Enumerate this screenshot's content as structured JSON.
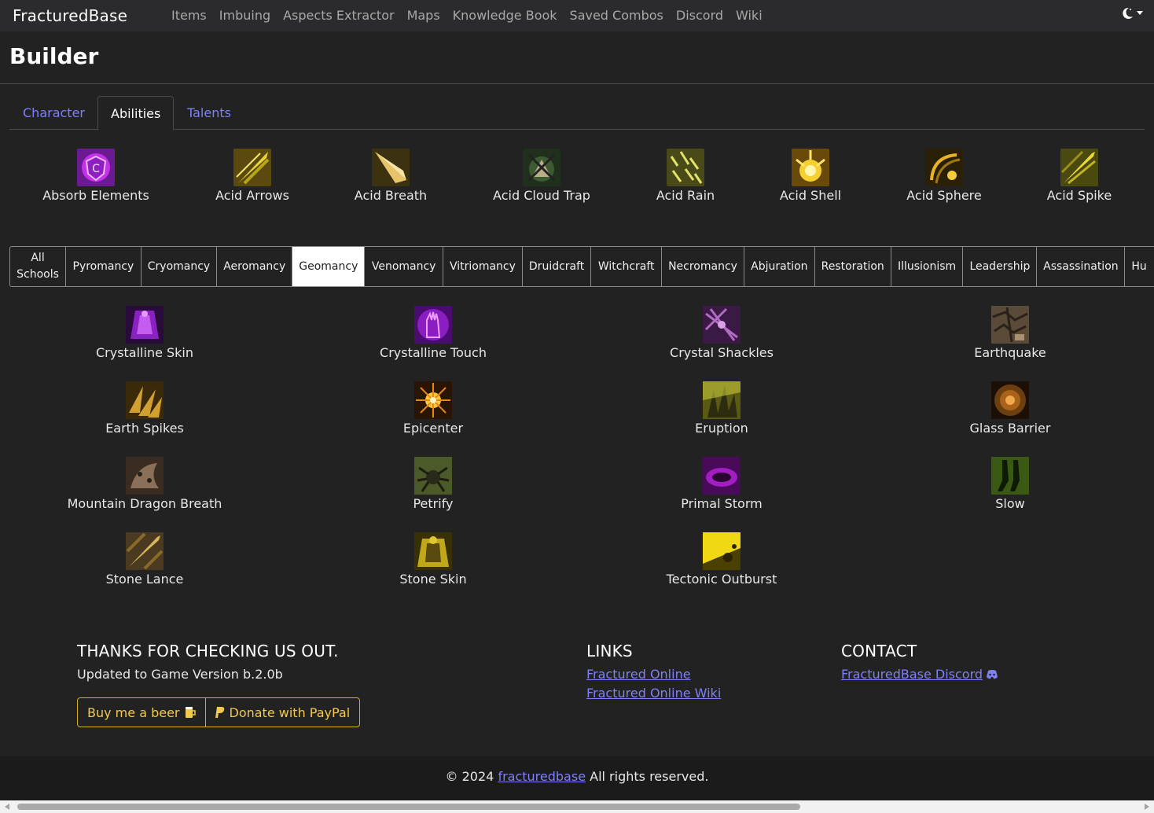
{
  "navbar": {
    "brand": "FracturedBase",
    "links": [
      "Items",
      "Imbuing",
      "Aspects Extractor",
      "Maps",
      "Knowledge Book",
      "Saved Combos",
      "Discord",
      "Wiki"
    ],
    "theme_icon": "moon-icon"
  },
  "page": {
    "title": "Builder"
  },
  "tabs": [
    {
      "label": "Character",
      "active": false
    },
    {
      "label": "Abilities",
      "active": true
    },
    {
      "label": "Talents",
      "active": false
    }
  ],
  "abilities": [
    {
      "label": "Absorb Elements",
      "icon": "absorb-elements-icon",
      "color": "#b02ad6"
    },
    {
      "label": "Acid Arrows",
      "icon": "acid-arrows-icon",
      "color": "#b3a417"
    },
    {
      "label": "Acid Breath",
      "icon": "acid-breath-icon",
      "color": "#c9a33a"
    },
    {
      "label": "Acid Cloud Trap",
      "icon": "acid-cloud-trap-icon",
      "color": "#3d5a36"
    },
    {
      "label": "Acid Rain",
      "icon": "acid-rain-icon",
      "color": "#9a9a2a"
    },
    {
      "label": "Acid Shell",
      "icon": "acid-shell-icon",
      "color": "#e0b81c"
    },
    {
      "label": "Acid Sphere",
      "icon": "acid-sphere-icon",
      "color": "#7a5e12"
    },
    {
      "label": "Acid Spike",
      "icon": "acid-spike-icon",
      "color": "#aaa320"
    }
  ],
  "schools": [
    {
      "label": "All Schools",
      "active": false
    },
    {
      "label": "Pyromancy",
      "active": false
    },
    {
      "label": "Cryomancy",
      "active": false
    },
    {
      "label": "Aeromancy",
      "active": false
    },
    {
      "label": "Geomancy",
      "active": true
    },
    {
      "label": "Venomancy",
      "active": false
    },
    {
      "label": "Vitriomancy",
      "active": false
    },
    {
      "label": "Druidcraft",
      "active": false
    },
    {
      "label": "Witchcraft",
      "active": false
    },
    {
      "label": "Necromancy",
      "active": false
    },
    {
      "label": "Abjuration",
      "active": false
    },
    {
      "label": "Restoration",
      "active": false
    },
    {
      "label": "Illusionism",
      "active": false
    },
    {
      "label": "Leadership",
      "active": false
    },
    {
      "label": "Assassination",
      "active": false
    },
    {
      "label": "Hu",
      "active": false
    }
  ],
  "spells": [
    {
      "label": "Crystalline Skin",
      "icon": "crystalline-skin-icon",
      "color": "#7a1fa8"
    },
    {
      "label": "Crystalline Touch",
      "icon": "crystalline-touch-icon",
      "color": "#8d18c2"
    },
    {
      "label": "Crystal Shackles",
      "icon": "crystal-shackles-icon",
      "color": "#6a2a7a"
    },
    {
      "label": "Earthquake",
      "icon": "earthquake-icon",
      "color": "#8a7455"
    },
    {
      "label": "Earth Spikes",
      "icon": "earth-spikes-icon",
      "color": "#a67c1c"
    },
    {
      "label": "Epicenter",
      "icon": "epicenter-icon",
      "color": "#d98a12"
    },
    {
      "label": "Eruption",
      "icon": "eruption-icon",
      "color": "#8e8a1c"
    },
    {
      "label": "Glass Barrier",
      "icon": "glass-barrier-icon",
      "color": "#6b3f10"
    },
    {
      "label": "Mountain Dragon Breath",
      "icon": "mountain-dragon-breath-icon",
      "color": "#6e5540"
    },
    {
      "label": "Petrify",
      "icon": "petrify-icon",
      "color": "#4f5a2a"
    },
    {
      "label": "Primal Storm",
      "icon": "primal-storm-icon",
      "color": "#7a1290"
    },
    {
      "label": "Slow",
      "icon": "slow-icon",
      "color": "#4c6a1c"
    },
    {
      "label": "Stone Lance",
      "icon": "stone-lance-icon",
      "color": "#8a6a2a"
    },
    {
      "label": "Stone Skin",
      "icon": "stone-skin-icon",
      "color": "#b09a14"
    },
    {
      "label": "Tectonic Outburst",
      "icon": "tectonic-outburst-icon",
      "color": "#c9b014"
    }
  ],
  "footer": {
    "thanks_heading": "THANKS FOR CHECKING US OUT.",
    "version_text": "Updated to Game Version b.2.0b",
    "beer_button": "Buy me a beer",
    "paypal_button": "Donate with PayPal",
    "links_heading": "LINKS",
    "links": [
      "Fractured Online",
      "Fractured Online Wiki"
    ],
    "contact_heading": "CONTACT",
    "discord_link": "FracturedBase Discord",
    "copyright_prefix": "© 2024",
    "copyright_link": "fracturedbase",
    "copyright_suffix": "All rights reserved."
  },
  "colors": {
    "accent_link": "#7f80f5",
    "button_accent": "#d4b21f",
    "background": "#222222"
  }
}
